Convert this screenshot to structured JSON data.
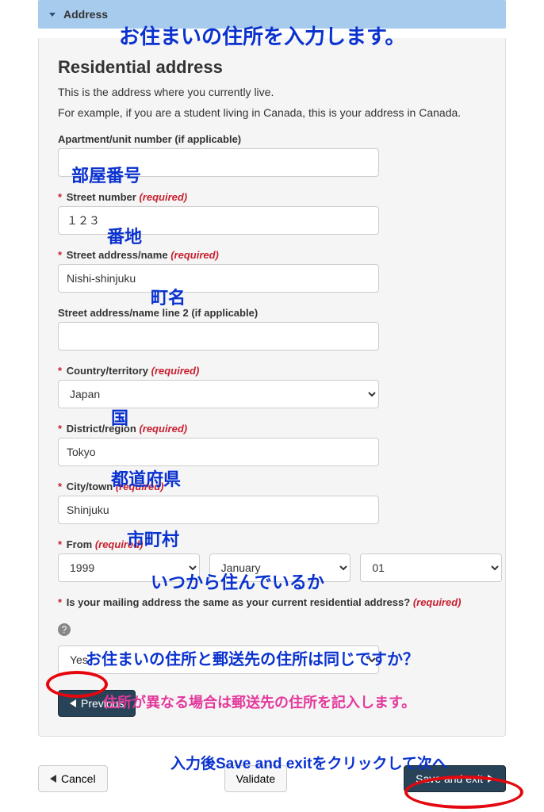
{
  "accordion": {
    "title": "Address"
  },
  "heading": "Residential address",
  "desc1": "This is the address where you currently live.",
  "desc2": "For example, if you are a student living in Canada, this is your address in Canada.",
  "required_word": "(required)",
  "fields": {
    "apt": {
      "label": "Apartment/unit number (if applicable)",
      "value": ""
    },
    "street_no": {
      "label": "Street number",
      "value": "１２３"
    },
    "street_name": {
      "label": "Street address/name",
      "value": "Nishi-shinjuku"
    },
    "street_name2": {
      "label": "Street address/name line 2 (if applicable)",
      "value": ""
    },
    "country": {
      "label": "Country/territory",
      "value": "Japan"
    },
    "district": {
      "label": "District/region",
      "value": "Tokyo"
    },
    "city": {
      "label": "City/town",
      "value": "Shinjuku"
    },
    "from": {
      "label": "From",
      "year": "1999",
      "month": "January",
      "day": "01"
    },
    "mailing_q": {
      "label": "Is your mailing address the same as your current residential address?",
      "value": "Yes"
    }
  },
  "buttons": {
    "previous": "Previous",
    "cancel": "Cancel",
    "validate": "Validate",
    "save_exit": "Save and exit"
  },
  "annotations": {
    "header": "お住まいの住所を入力します。",
    "apt": "部屋番号",
    "street_no": "番地",
    "street_name": "町名",
    "country": "国",
    "district": "都道府県",
    "city": "市町村",
    "from": "いつから住んでいるか",
    "mailing_q": "お住まいの住所と郵送先の住所は同じですか？",
    "mailing_note": "住所が異なる場合は郵送先の住所を記入します。",
    "save_note": "入力後Save and exitをクリックして次へ"
  }
}
